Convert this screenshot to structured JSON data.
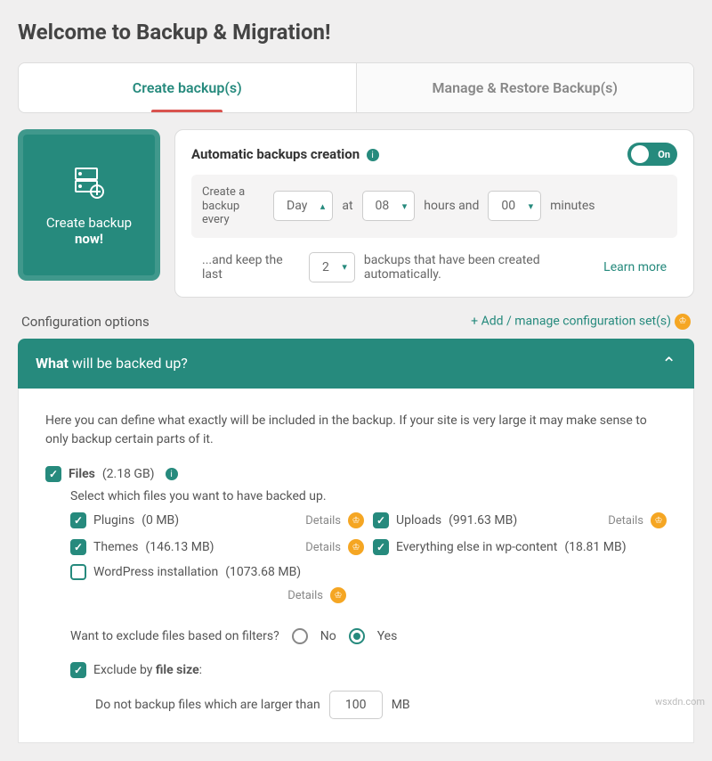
{
  "title": "Welcome to Backup & Migration!",
  "tabs": {
    "create": "Create backup(s)",
    "manage": "Manage & Restore Backup(s)"
  },
  "createNow": {
    "line1": "Create backup",
    "line2": "now!"
  },
  "auto": {
    "title": "Automatic backups creation",
    "toggle": "On",
    "label_every": "Create a backup every",
    "period": "Day",
    "at": "at",
    "hours_val": "08",
    "hours_lbl": "hours and",
    "mins_val": "00",
    "mins_lbl": "minutes",
    "keep_pre": "...and keep the last",
    "keep_val": "2",
    "keep_post": "backups that have been created automatically.",
    "learn": "Learn more"
  },
  "config": {
    "label": "Configuration options",
    "add": "+ Add / manage configuration set(s)"
  },
  "accordion": {
    "title_bold": "What",
    "title_rest": " will be backed up?",
    "intro": "Here you can define what exactly will be included in the backup. If your site is very large it may make sense to only backup certain parts of it.",
    "files_label": "Files",
    "files_size": "(2.18 GB)",
    "select_hint": "Select which files you want to have backed up.",
    "plugins": "Plugins",
    "plugins_size": "(0 MB)",
    "uploads": "Uploads",
    "uploads_size": "(991.63 MB)",
    "themes": "Themes",
    "themes_size": "(146.13 MB)",
    "else": "Everything else in wp-content",
    "else_size": "(18.81 MB)",
    "wp": "WordPress installation",
    "wp_size": "(1073.68 MB)",
    "details": "Details",
    "filters_q": "Want to exclude files based on filters?",
    "no": "No",
    "yes": "Yes",
    "excl_pre": "Exclude by ",
    "excl_bold": "file size",
    "excl_post": ":",
    "excl_rule_pre": "Do not backup files which are larger than",
    "excl_val": "100",
    "excl_unit": "MB"
  },
  "watermark": "wsxdn.com"
}
